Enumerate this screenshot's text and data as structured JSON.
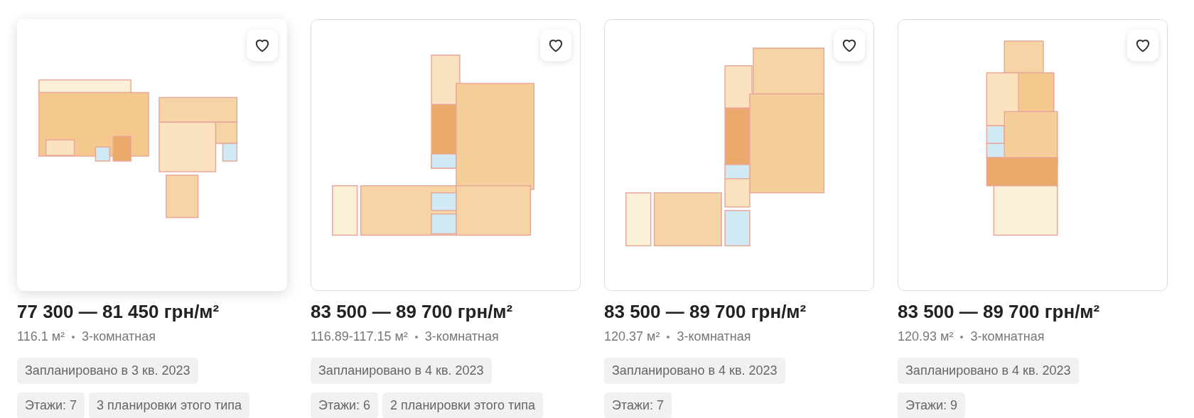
{
  "listings": [
    {
      "hovered": true,
      "favorite": false,
      "price": "77 300 — 81 450 грн/м²",
      "area": "116.1 м²",
      "rooms": "3-комнатная",
      "tags": [
        "Запланировано в 3 кв. 2023",
        "Этажи: 7",
        "3 планировки этого типа"
      ]
    },
    {
      "hovered": false,
      "favorite": false,
      "price": "83 500 — 89 700 грн/м²",
      "area": "116.89-117.15 м²",
      "rooms": "3-комнатная",
      "tags": [
        "Запланировано в 4 кв. 2023",
        "Этажи: 6",
        "2 планировки этого типа"
      ]
    },
    {
      "hovered": false,
      "favorite": false,
      "price": "83 500 — 89 700 грн/м²",
      "area": "120.37 м²",
      "rooms": "3-комнатная",
      "tags": [
        "Запланировано в 4 кв. 2023",
        "Этажи: 7"
      ]
    },
    {
      "hovered": false,
      "favorite": false,
      "price": "83 500 — 89 700 грн/м²",
      "area": "120.93 м²",
      "rooms": "3-комнатная",
      "tags": [
        "Запланировано в 4 кв. 2023",
        "Этажи: 9"
      ]
    }
  ]
}
